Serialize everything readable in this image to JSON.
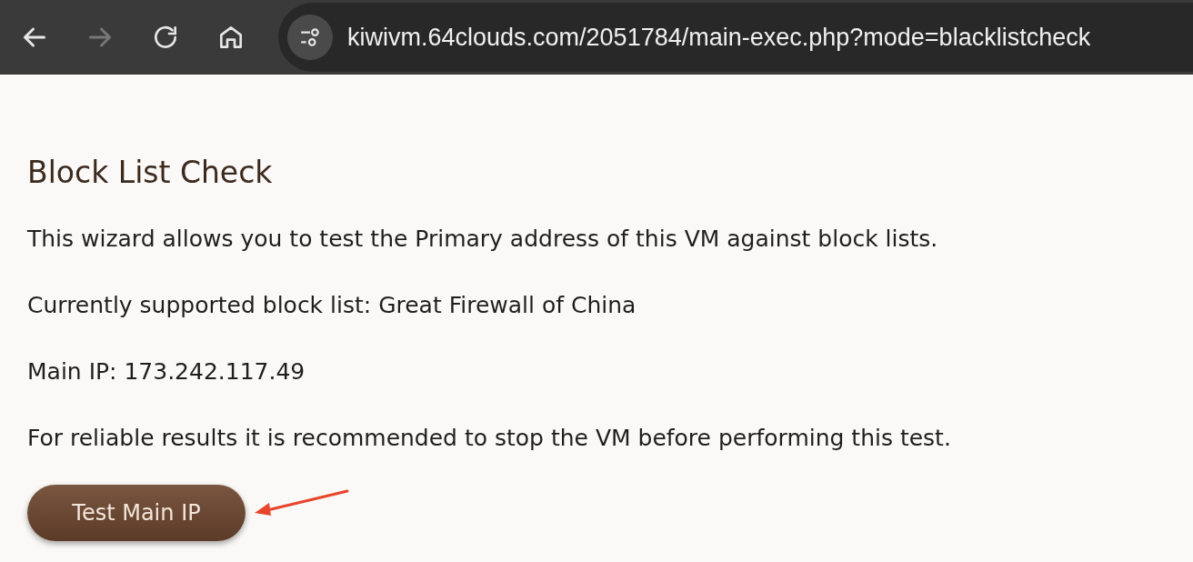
{
  "browser": {
    "url": "kiwivm.64clouds.com/2051784/main-exec.php?mode=blacklistcheck"
  },
  "heading": "Block List Check",
  "paragraphs": [
    "This wizard allows you to test the Primary address of this VM against block lists.",
    "Currently supported block list: Great Firewall of China",
    "Main IP: 173.242.117.49",
    "For reliable results it is recommended to stop the VM before performing this test."
  ],
  "button": {
    "label": "Test Main IP"
  }
}
